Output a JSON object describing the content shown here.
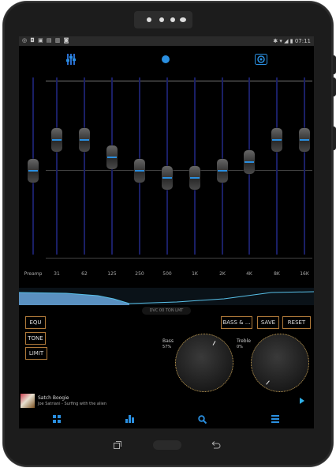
{
  "status_bar": {
    "time": "07:11"
  },
  "eq_bands": [
    {
      "label": "Preamp",
      "level": 0.49
    },
    {
      "label": "31",
      "level": 0.67
    },
    {
      "label": "62",
      "level": 0.67
    },
    {
      "label": "125",
      "level": 0.57
    },
    {
      "label": "250",
      "level": 0.49
    },
    {
      "label": "500",
      "level": 0.45
    },
    {
      "label": "1K",
      "level": 0.45
    },
    {
      "label": "2K",
      "level": 0.49
    },
    {
      "label": "4K",
      "level": 0.54
    },
    {
      "label": "8K",
      "level": 0.67
    },
    {
      "label": "16K",
      "level": 0.67
    }
  ],
  "toggle": {
    "label": "DVC 00 TON LMT"
  },
  "modes": {
    "equ": "EQU",
    "tone": "TONE",
    "limit": "LIMIT"
  },
  "actions": {
    "bass": "BASS & ...",
    "save": "SAVE",
    "reset": "RESET"
  },
  "bass": {
    "label": "Bass",
    "value": "57%"
  },
  "treble": {
    "label": "Treble",
    "value": "0%"
  },
  "now_playing": {
    "title": "Satch Boogie",
    "subtitle": "Joe Satriani - Surfing with the alien"
  },
  "colors": {
    "accent": "#2a8fe0",
    "button_border": "#b07a3a",
    "play": "#2fb0e8"
  },
  "icons": [
    "sliders-icon",
    "dot-icon",
    "speaker-icon",
    "grid-icon",
    "bar-chart-icon",
    "search-icon",
    "menu-icon"
  ]
}
